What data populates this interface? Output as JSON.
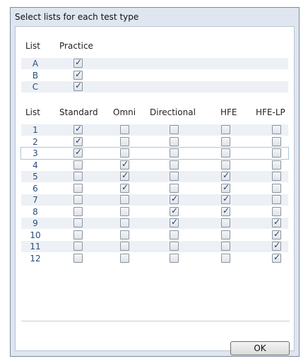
{
  "dialog": {
    "title": "Select lists for each test type",
    "ok_label": "OK"
  },
  "practice": {
    "headers": [
      "List",
      "Practice"
    ],
    "rows": [
      {
        "label": "A",
        "practice": true
      },
      {
        "label": "B",
        "practice": true
      },
      {
        "label": "C",
        "practice": true
      }
    ]
  },
  "tests": {
    "headers": [
      "List",
      "Standard",
      "Omni",
      "Directional",
      "HFE",
      "HFE-LP"
    ],
    "selected_row": 2,
    "rows": [
      {
        "label": "1",
        "checks": [
          true,
          false,
          false,
          false,
          false
        ]
      },
      {
        "label": "2",
        "checks": [
          true,
          false,
          false,
          false,
          false
        ]
      },
      {
        "label": "3",
        "checks": [
          true,
          false,
          false,
          false,
          false
        ]
      },
      {
        "label": "4",
        "checks": [
          false,
          true,
          false,
          false,
          false
        ]
      },
      {
        "label": "5",
        "checks": [
          false,
          true,
          false,
          true,
          false
        ]
      },
      {
        "label": "6",
        "checks": [
          false,
          true,
          false,
          true,
          false
        ]
      },
      {
        "label": "7",
        "checks": [
          false,
          false,
          true,
          true,
          false
        ]
      },
      {
        "label": "8",
        "checks": [
          false,
          false,
          true,
          true,
          false
        ]
      },
      {
        "label": "9",
        "checks": [
          false,
          false,
          true,
          false,
          true
        ]
      },
      {
        "label": "10",
        "checks": [
          false,
          false,
          false,
          false,
          true
        ]
      },
      {
        "label": "11",
        "checks": [
          false,
          false,
          false,
          false,
          true
        ]
      },
      {
        "label": "12",
        "checks": [
          false,
          false,
          false,
          false,
          true
        ]
      }
    ]
  }
}
